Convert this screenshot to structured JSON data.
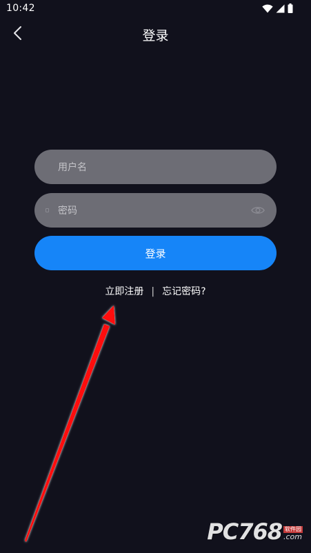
{
  "status_bar": {
    "time": "10:42"
  },
  "header": {
    "title": "登录"
  },
  "form": {
    "username_placeholder": "用户名",
    "username_value": "",
    "password_placeholder": "密码",
    "password_value": "",
    "login_button": "登录"
  },
  "links": {
    "register": "立即注册",
    "separator": "|",
    "forgot_password": "忘记密码?"
  },
  "watermark": {
    "logo": "PC768",
    "tag": "软件园",
    "domain": ".com"
  },
  "colors": {
    "background": "#11111c",
    "input_bg": "#6d6d75",
    "primary_button": "#1685f8",
    "annotation_arrow": "#ff1010"
  },
  "icons": {
    "back": "chevron-left-icon",
    "password_toggle": "eye-icon",
    "wifi": "wifi-icon",
    "signal": "cellular-signal-icon",
    "battery": "battery-icon"
  }
}
